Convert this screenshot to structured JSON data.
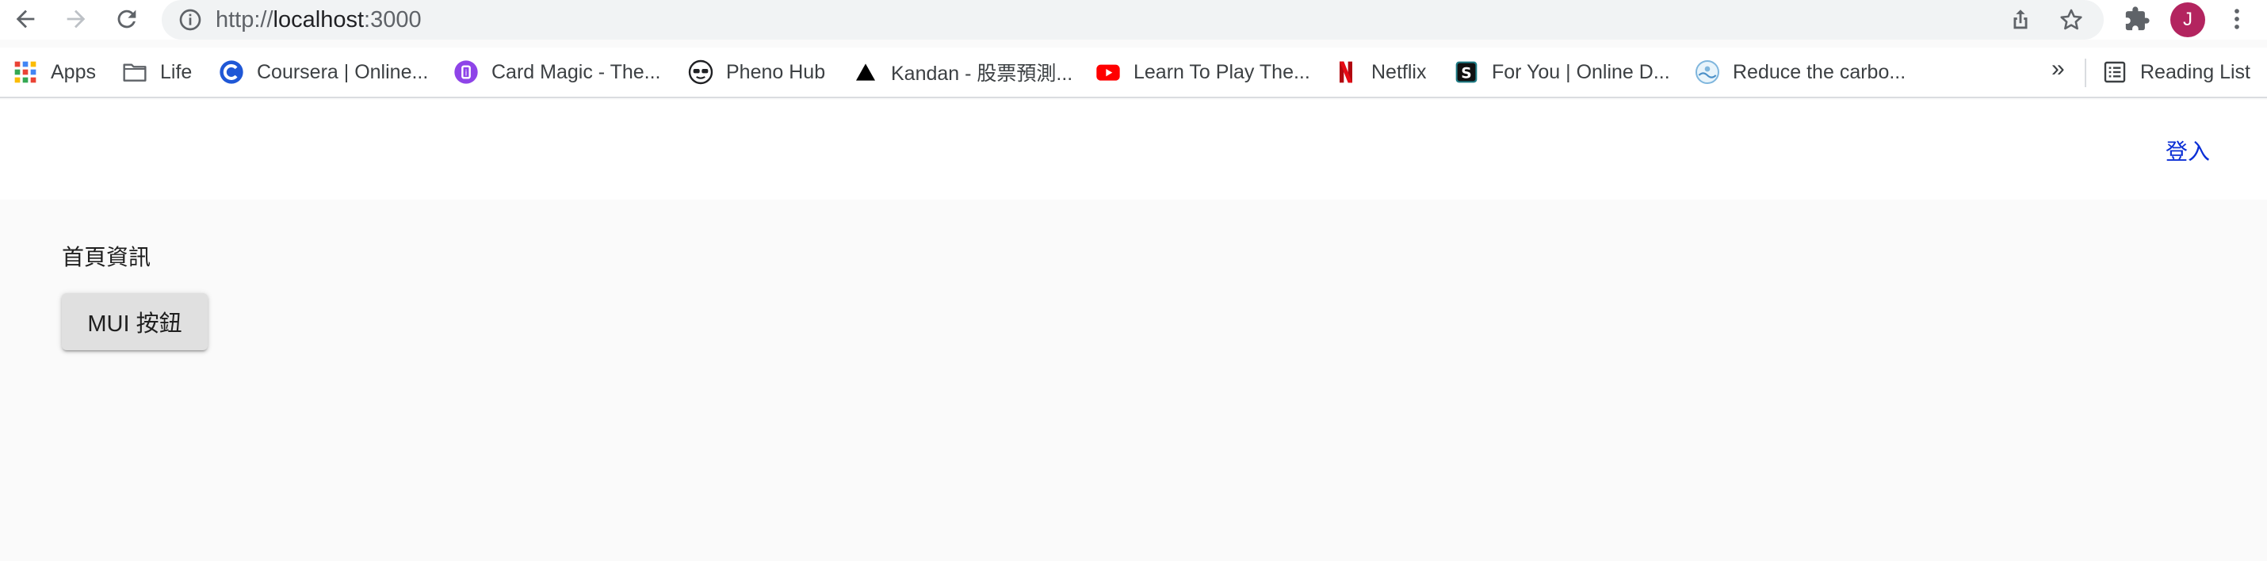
{
  "browser": {
    "url_scheme": "http://",
    "url_host": "localhost",
    "url_port": ":3000",
    "avatar_letter": "J",
    "avatar_color": "#b3245f"
  },
  "bookmarks": {
    "items": [
      {
        "label": "Apps",
        "icon": "apps-grid-icon"
      },
      {
        "label": "Life",
        "icon": "folder-icon"
      },
      {
        "label": "Coursera | Online...",
        "icon": "coursera-icon"
      },
      {
        "label": "Card Magic - The...",
        "icon": "card-magic-icon"
      },
      {
        "label": "Pheno Hub",
        "icon": "pheno-hub-icon"
      },
      {
        "label": "Kandan - 股票預測...",
        "icon": "kandan-icon"
      },
      {
        "label": "Learn To Play The...",
        "icon": "youtube-icon"
      },
      {
        "label": "Netflix",
        "icon": "netflix-icon"
      },
      {
        "label": "For You | Online D...",
        "icon": "scribd-icon"
      },
      {
        "label": "Reduce the carbo...",
        "icon": "reduce-carbon-icon"
      }
    ],
    "overflow": "»",
    "reading_list": "Reading List"
  },
  "page": {
    "login_label": "登入",
    "home_info": "首頁資訊",
    "mui_button_label": "MUI 按鈕",
    "link_color": "#0b2fd6"
  }
}
